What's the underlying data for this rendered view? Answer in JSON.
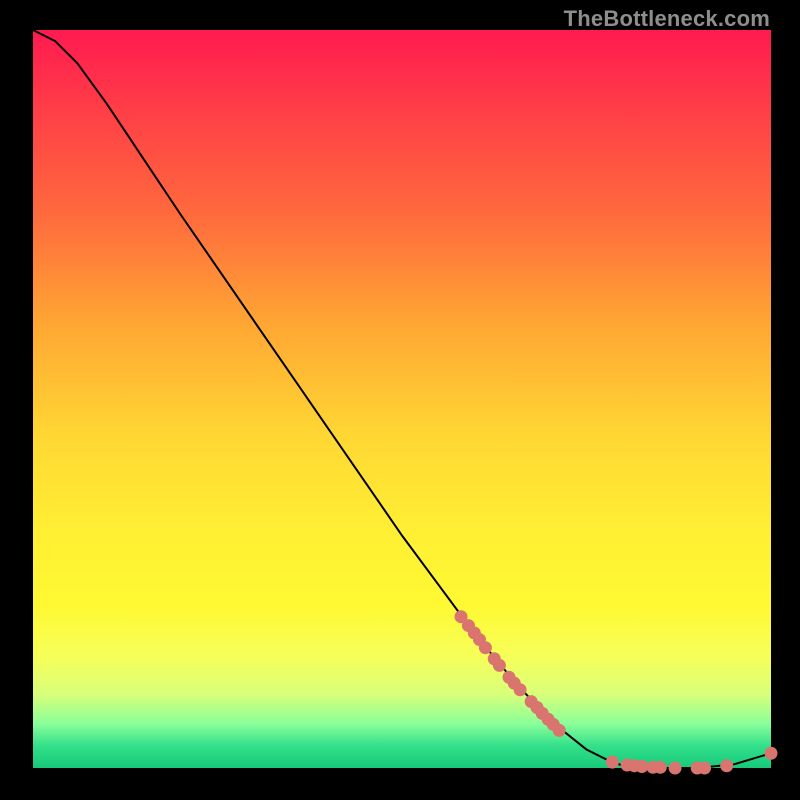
{
  "watermark": "TheBottleneck.com",
  "colors": {
    "curve": "#000000",
    "dot_fill": "#d9746e",
    "dot_stroke": "#d9746e",
    "gradient_top": "#ff1a50",
    "gradient_bottom": "#17c97a"
  },
  "chart_data": {
    "type": "line",
    "title": "",
    "xlabel": "",
    "ylabel": "",
    "xlim": [
      0,
      100
    ],
    "ylim": [
      0,
      100
    ],
    "curve": [
      {
        "x": 0,
        "y": 100.0
      },
      {
        "x": 3,
        "y": 98.5
      },
      {
        "x": 6,
        "y": 95.5
      },
      {
        "x": 10,
        "y": 90.0
      },
      {
        "x": 15,
        "y": 82.5
      },
      {
        "x": 20,
        "y": 75.0
      },
      {
        "x": 30,
        "y": 60.5
      },
      {
        "x": 40,
        "y": 46.0
      },
      {
        "x": 50,
        "y": 31.5
      },
      {
        "x": 60,
        "y": 18.0
      },
      {
        "x": 65,
        "y": 12.0
      },
      {
        "x": 70,
        "y": 6.5
      },
      {
        "x": 75,
        "y": 2.5
      },
      {
        "x": 78,
        "y": 1.0
      },
      {
        "x": 80,
        "y": 0.3
      },
      {
        "x": 85,
        "y": 0.0
      },
      {
        "x": 90,
        "y": 0.0
      },
      {
        "x": 95,
        "y": 0.5
      },
      {
        "x": 100,
        "y": 2.0
      }
    ],
    "dots": [
      {
        "x": 58.0,
        "y": 20.5,
        "r": 6
      },
      {
        "x": 59.0,
        "y": 19.3,
        "r": 6
      },
      {
        "x": 59.8,
        "y": 18.3,
        "r": 6
      },
      {
        "x": 60.5,
        "y": 17.4,
        "r": 6
      },
      {
        "x": 61.3,
        "y": 16.3,
        "r": 6
      },
      {
        "x": 62.5,
        "y": 14.8,
        "r": 6
      },
      {
        "x": 63.2,
        "y": 13.9,
        "r": 6
      },
      {
        "x": 64.5,
        "y": 12.3,
        "r": 6
      },
      {
        "x": 65.2,
        "y": 11.5,
        "r": 6
      },
      {
        "x": 66.0,
        "y": 10.6,
        "r": 6
      },
      {
        "x": 67.5,
        "y": 9.0,
        "r": 6
      },
      {
        "x": 68.3,
        "y": 8.2,
        "r": 6
      },
      {
        "x": 69.0,
        "y": 7.4,
        "r": 6
      },
      {
        "x": 69.8,
        "y": 6.6,
        "r": 6
      },
      {
        "x": 70.5,
        "y": 5.9,
        "r": 6
      },
      {
        "x": 71.3,
        "y": 5.1,
        "r": 6
      },
      {
        "x": 78.5,
        "y": 0.8,
        "r": 6
      },
      {
        "x": 80.5,
        "y": 0.4,
        "r": 6
      },
      {
        "x": 81.5,
        "y": 0.3,
        "r": 6
      },
      {
        "x": 82.5,
        "y": 0.2,
        "r": 6
      },
      {
        "x": 84.0,
        "y": 0.1,
        "r": 6
      },
      {
        "x": 85.0,
        "y": 0.1,
        "r": 6
      },
      {
        "x": 87.0,
        "y": 0.0,
        "r": 6
      },
      {
        "x": 90.0,
        "y": 0.0,
        "r": 6
      },
      {
        "x": 91.0,
        "y": 0.0,
        "r": 6
      },
      {
        "x": 94.0,
        "y": 0.3,
        "r": 6
      },
      {
        "x": 100.0,
        "y": 2.0,
        "r": 6
      }
    ]
  }
}
